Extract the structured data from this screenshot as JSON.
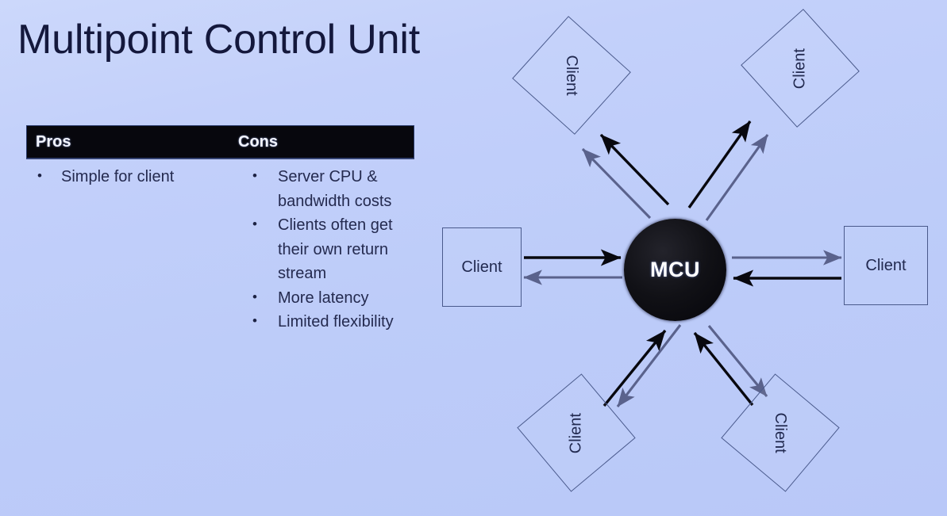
{
  "slide": {
    "title": "Multipoint Control Unit",
    "background_top": "#ccd8fb",
    "background_bottom": "#b9c8f8",
    "title_color": "#14183c"
  },
  "table": {
    "header": {
      "pros": "Pros",
      "cons": "Cons",
      "bg_color": "#07070d",
      "text_color": "#f2f4ff"
    },
    "pros_items": [
      "Simple for client"
    ],
    "cons_items": [
      "Server CPU & bandwidth costs",
      "Clients often get their own return stream",
      "More latency",
      "Limited flexibility"
    ]
  },
  "diagram": {
    "type": "star-topology",
    "hub": {
      "label": "MCU",
      "shape": "circle",
      "fill": "#07070c",
      "text_color": "#ffffff"
    },
    "nodes": [
      {
        "id": "client-left",
        "label": "Client",
        "position": "left",
        "rotation_deg": 0
      },
      {
        "id": "client-right",
        "label": "Client",
        "position": "right",
        "rotation_deg": 0
      },
      {
        "id": "client-tl",
        "label": "Client",
        "position": "top-left",
        "rotation_deg": 42
      },
      {
        "id": "client-tr",
        "label": "Client",
        "position": "top-right",
        "rotation_deg": -42
      },
      {
        "id": "client-bl",
        "label": "Client",
        "position": "bottom-left",
        "rotation_deg": -40
      },
      {
        "id": "client-br",
        "label": "Client",
        "position": "bottom-right",
        "rotation_deg": 40
      }
    ],
    "edges": {
      "inbound_color": "#08080e",
      "inbound_label": "client to MCU",
      "outbound_color": "#5a628c",
      "outbound_label": "MCU to client",
      "pairs_per_client": 2,
      "total_clients": 6
    },
    "node_border_color": "#4a5a8c",
    "node_text_color": "#222a50"
  }
}
